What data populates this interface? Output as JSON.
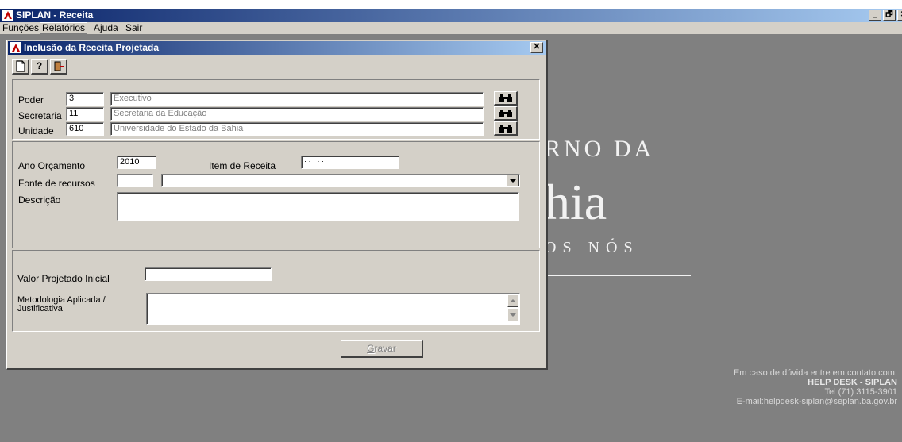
{
  "app": {
    "title": "SIPLAN - Receita"
  },
  "menu": {
    "items": [
      "Funções",
      "Relatórios",
      "Ajuda",
      "Sair"
    ]
  },
  "dialog": {
    "title": "Inclusão da Receita Projetada",
    "toolbar": {
      "help_label": "?"
    },
    "poder": {
      "label": "Poder",
      "code": "3",
      "name": "Executivo"
    },
    "secretaria": {
      "label": "Secretaria",
      "code": "11",
      "name": "Secretaria da Educação"
    },
    "unidade": {
      "label": "Unidade",
      "code": "610",
      "name": "Universidade do Estado da Bahia"
    },
    "ano": {
      "label": "Ano Orçamento",
      "value": "2010"
    },
    "item_receita": {
      "label": "Item de Receita",
      "value": " · · · · ·"
    },
    "fonte": {
      "label": "Fonte de recursos",
      "code": "",
      "selected": ""
    },
    "descricao": {
      "label": "Descrição",
      "value": ""
    },
    "valor": {
      "label": "Valor Projetado Inicial",
      "value": ""
    },
    "metodologia": {
      "label_line1": "Metodologia Aplicada /",
      "label_line2": "Justificativa",
      "value": ""
    },
    "gravar_label": "Gravar"
  },
  "background": {
    "line1": "RNO DA",
    "line2": "hia",
    "line3": "OS NÓS"
  },
  "help": {
    "line1": "Em caso de dúvida entre em contato com:",
    "line2": "HELP DESK - SIPLAN",
    "line3": "Tel (71) 3115-3901",
    "line4": "E-mail:helpdesk-siplan@seplan.ba.gov.br"
  },
  "colors": {
    "titlebar": "#0a246a",
    "face": "#d4d0c8",
    "desktop": "#808080"
  },
  "icons": [
    "app-logo-icon",
    "new-document-icon",
    "exit-door-icon",
    "binoculars-icon",
    "dropdown-arrow-icon",
    "scroll-up-icon",
    "scroll-down-icon"
  ]
}
